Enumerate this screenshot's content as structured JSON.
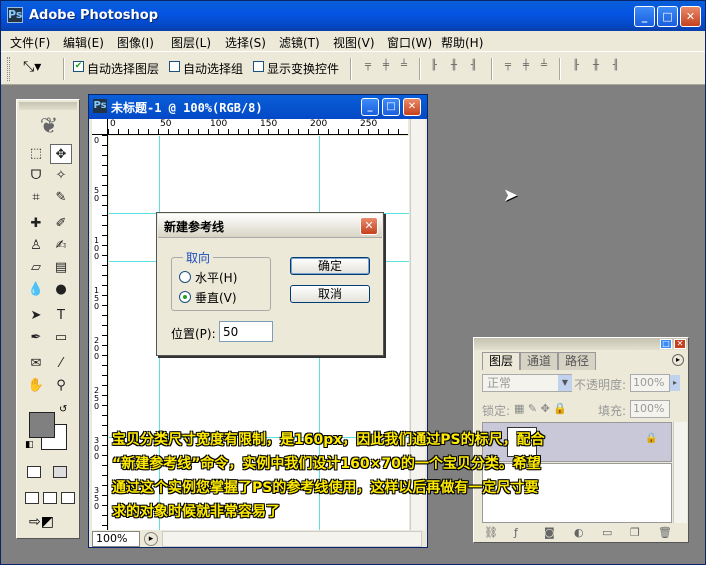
{
  "app": {
    "title": "Adobe Photoshop",
    "icon": "photoshop-icon"
  },
  "window_controls": {
    "minimize": "_",
    "maximize": "□",
    "close": "✕"
  },
  "menu": [
    "文件(F)",
    "编辑(E)",
    "图像(I)",
    "图层(L)",
    "选择(S)",
    "滤镜(T)",
    "视图(V)",
    "窗口(W)",
    "帮助(H)"
  ],
  "options": {
    "tool_icon": "move-tool-icon",
    "auto_select_layer": "自动选择图层",
    "auto_select_layer_checked": true,
    "auto_select_group": "自动选择组",
    "show_transform_controls": "显示变换控件"
  },
  "document": {
    "title": "未标题-1 @ 100%(RGB/8)",
    "zoom": "100%",
    "ruler_h": [
      "0",
      "50",
      "100",
      "150",
      "200",
      "250"
    ],
    "ruler_v": [
      "0",
      "5 0",
      "1 0 0",
      "1 5 0",
      "2 0 0",
      "2 5 0",
      "3 0 0",
      "3 5 0"
    ]
  },
  "dialog": {
    "title": "新建参考线",
    "group_label": "取向",
    "horizontal": "水平(H)",
    "vertical": "垂直(V)",
    "selected": "vertical",
    "ok": "确定",
    "cancel": "取消",
    "position_label": "位置(P):",
    "position_value": "50"
  },
  "layers": {
    "tabs": [
      "图层",
      "通道",
      "路径"
    ],
    "blend_mode": "正常",
    "opacity_label": "不透明度:",
    "opacity_value": "100%",
    "lock_label": "锁定:",
    "fill_label": "填充:",
    "fill_value": "100%"
  },
  "caption": [
    "宝贝分类尺寸宽度有限制，是160px，因此我们通过PS的标尺，配合",
    "“新建参考线”命令，实例中我们设计160×70的一个宝贝分类。希望",
    "通过这个实例您掌握了PS的参考线使用，这样以后再做有一定尺寸要",
    "求的对象时候就非常容易了"
  ]
}
